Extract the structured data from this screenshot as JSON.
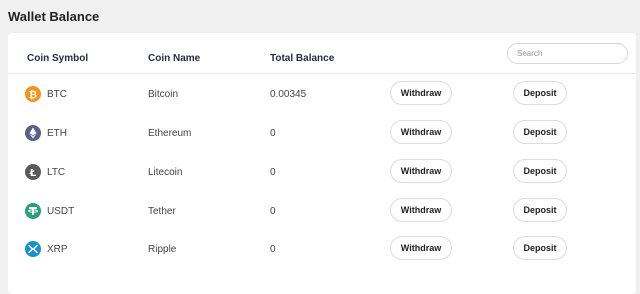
{
  "page": {
    "title": "Wallet Balance"
  },
  "table": {
    "headers": {
      "symbol": "Coin Symbol",
      "name": "Coin Name",
      "balance": "Total Balance"
    },
    "search_placeholder": "Search",
    "withdraw_label": "Withdraw",
    "deposit_label": "Deposit",
    "rows": [
      {
        "symbol": "BTC",
        "name": "Bitcoin",
        "balance": "0.00345",
        "icon": "bitcoin-icon",
        "color": "#f7931a"
      },
      {
        "symbol": "ETH",
        "name": "Ethereum",
        "balance": "0",
        "icon": "ethereum-icon",
        "color": "#5a5f8a"
      },
      {
        "symbol": "LTC",
        "name": "Litecoin",
        "balance": "0",
        "icon": "litecoin-icon",
        "color": "#5a5a5a"
      },
      {
        "symbol": "USDT",
        "name": "Tether",
        "balance": "0",
        "icon": "tether-icon",
        "color": "#26a17b"
      },
      {
        "symbol": "XRP",
        "name": "Ripple",
        "balance": "0",
        "icon": "ripple-icon",
        "color": "#1a8fd0"
      }
    ]
  }
}
